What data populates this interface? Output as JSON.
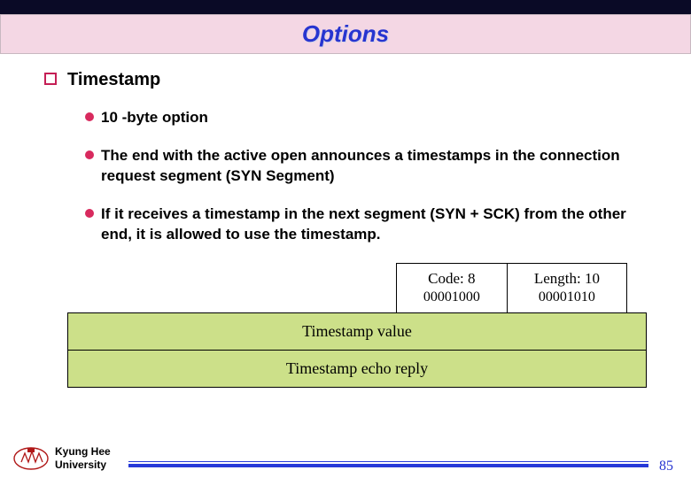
{
  "title": "Options",
  "section": "Timestamp",
  "bullets": [
    "10 -byte option",
    "The end with the active open announces a timestamps in the connection request segment (SYN Segment)",
    "If it receives a timestamp in the next segment (SYN + SCK) from the other end, it is allowed to use the timestamp."
  ],
  "diagram": {
    "code_label": "Code: 8",
    "code_binary": "00001000",
    "length_label": "Length: 10",
    "length_binary": "00001010",
    "row1": "Timestamp value",
    "row2": "Timestamp echo reply"
  },
  "footer": {
    "university_line1": "Kyung Hee",
    "university_line2": "University",
    "page": "85"
  }
}
